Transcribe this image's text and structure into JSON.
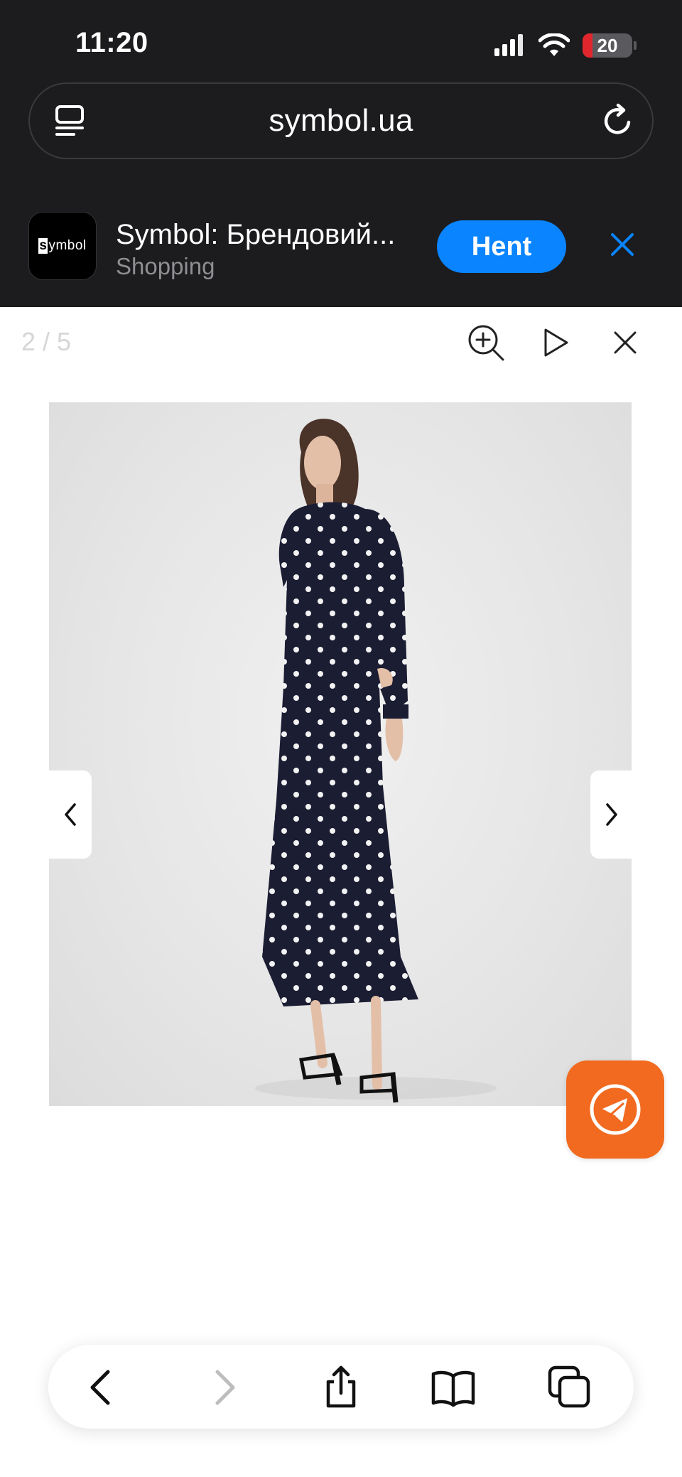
{
  "status_bar": {
    "time": "11:20",
    "battery_level": "20",
    "icons": [
      "cellular-signal-icon",
      "wifi-icon",
      "battery-icon"
    ]
  },
  "browser": {
    "url": "symbol.ua",
    "icons": [
      "tabs-overview-icon",
      "reload-icon"
    ]
  },
  "app_banner": {
    "app_name": "Symbol: Брендовий...",
    "logo_text": "ymbol",
    "logo_letter": "s",
    "category": "Shopping",
    "open_label": "Hent",
    "open_color": "#0a84ff"
  },
  "gallery": {
    "counter": "2 / 5",
    "current": 2,
    "total": 5,
    "tools": [
      "zoom-in-icon",
      "slideshow-play-icon",
      "close-icon"
    ],
    "image": "Model wearing a long-sleeve navy maxi dress with white polka dots and black strappy heels"
  },
  "floating": {
    "telegram_color": "#f16a1f"
  },
  "toolbar": {
    "items": [
      "back-icon",
      "forward-icon",
      "share-icon",
      "bookmarks-icon",
      "tabs-icon"
    ]
  }
}
